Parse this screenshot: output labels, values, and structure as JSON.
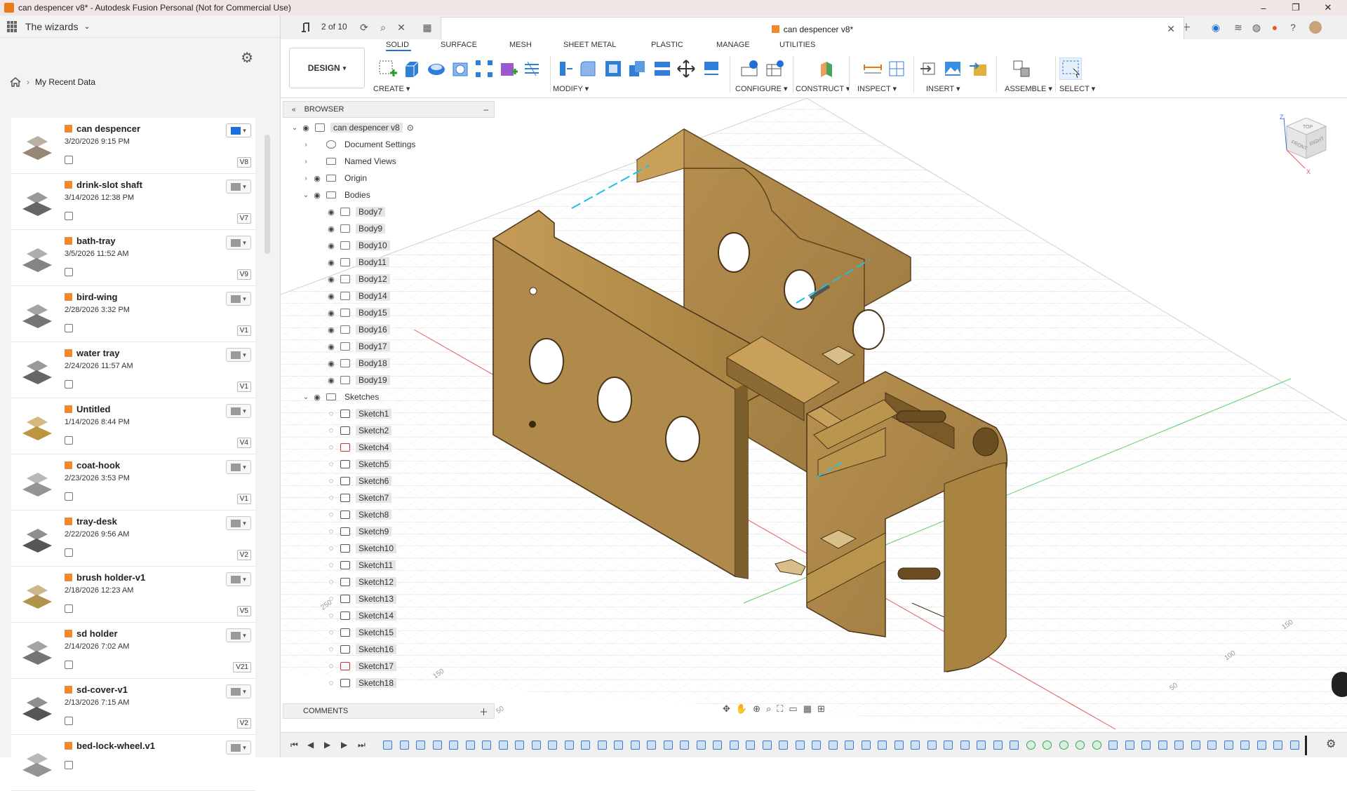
{
  "window": {
    "title": "can despencer v8* - Autodesk Fusion Personal (Not for Commercial Use)",
    "minimize": "–",
    "maximize": "❐",
    "close": "✕"
  },
  "left_panel": {
    "project": "The wizards",
    "counter": "2 of 10",
    "breadcrumb_label": "My Recent Data",
    "files": [
      {
        "name": "can despencer",
        "date": "3/20/2026 9:15 PM",
        "version": "V8",
        "active": true
      },
      {
        "name": "drink-slot shaft",
        "date": "3/14/2026 12:38 PM",
        "version": "V7"
      },
      {
        "name": "bath-tray",
        "date": "3/5/2026 11:52 AM",
        "version": "V9"
      },
      {
        "name": "bird-wing",
        "date": "2/28/2026 3:32 PM",
        "version": "V1"
      },
      {
        "name": "water tray",
        "date": "2/24/2026 11:57 AM",
        "version": "V1"
      },
      {
        "name": "Untitled",
        "date": "1/14/2026 8:44 PM",
        "version": "V4"
      },
      {
        "name": "coat-hook",
        "date": "2/23/2026 3:53 PM",
        "version": "V1"
      },
      {
        "name": "tray-desk",
        "date": "2/22/2026 9:56 AM",
        "version": "V2"
      },
      {
        "name": "brush holder-v1",
        "date": "2/18/2026 12:23 AM",
        "version": "V5"
      },
      {
        "name": "sd holder",
        "date": "2/14/2026 7:02 AM",
        "version": "V21"
      },
      {
        "name": "sd-cover-v1",
        "date": "2/13/2026 7:15 AM",
        "version": "V2"
      },
      {
        "name": "bed-lock-wheel.v1",
        "date": "",
        "version": ""
      }
    ]
  },
  "document_tab": {
    "title": "can despencer v8*"
  },
  "toolbar": {
    "workspace": "DESIGN",
    "tabs": [
      "SOLID",
      "SURFACE",
      "MESH",
      "SHEET METAL",
      "PLASTIC",
      "MANAGE",
      "UTILITIES"
    ],
    "groups": [
      "CREATE",
      "MODIFY",
      "CONFIGURE",
      "CONSTRUCT",
      "INSPECT",
      "INSERT",
      "ASSEMBLE",
      "SELECT"
    ]
  },
  "browser": {
    "header": "BROWSER",
    "root": "can despencer v8",
    "items": [
      "Document Settings",
      "Named Views",
      "Origin",
      "Bodies"
    ],
    "bodies": [
      "Body7",
      "Body9",
      "Body10",
      "Body11",
      "Body12",
      "Body14",
      "Body15",
      "Body16",
      "Body17",
      "Body18",
      "Body19"
    ],
    "sketches_label": "Sketches",
    "sketches": [
      "Sketch1",
      "Sketch2",
      "Sketch4",
      "Sketch5",
      "Sketch6",
      "Sketch7",
      "Sketch8",
      "Sketch9",
      "Sketch10",
      "Sketch11",
      "Sketch12",
      "Sketch13",
      "Sketch14",
      "Sketch15",
      "Sketch16",
      "Sketch17",
      "Sketch18"
    ]
  },
  "comments_label": "COMMENTS",
  "viewcube": {
    "top": "TOP",
    "front": "FRONT",
    "right": "RIGHT",
    "z": "Z",
    "x": "X"
  },
  "grid_labels": [
    "250",
    "150",
    "100",
    "50",
    "150",
    "50"
  ],
  "colors": {
    "part": "#b08a4a",
    "part_dark": "#7d5f2c",
    "accent": "#1e6fd9",
    "orange": "#ee8a2a"
  }
}
